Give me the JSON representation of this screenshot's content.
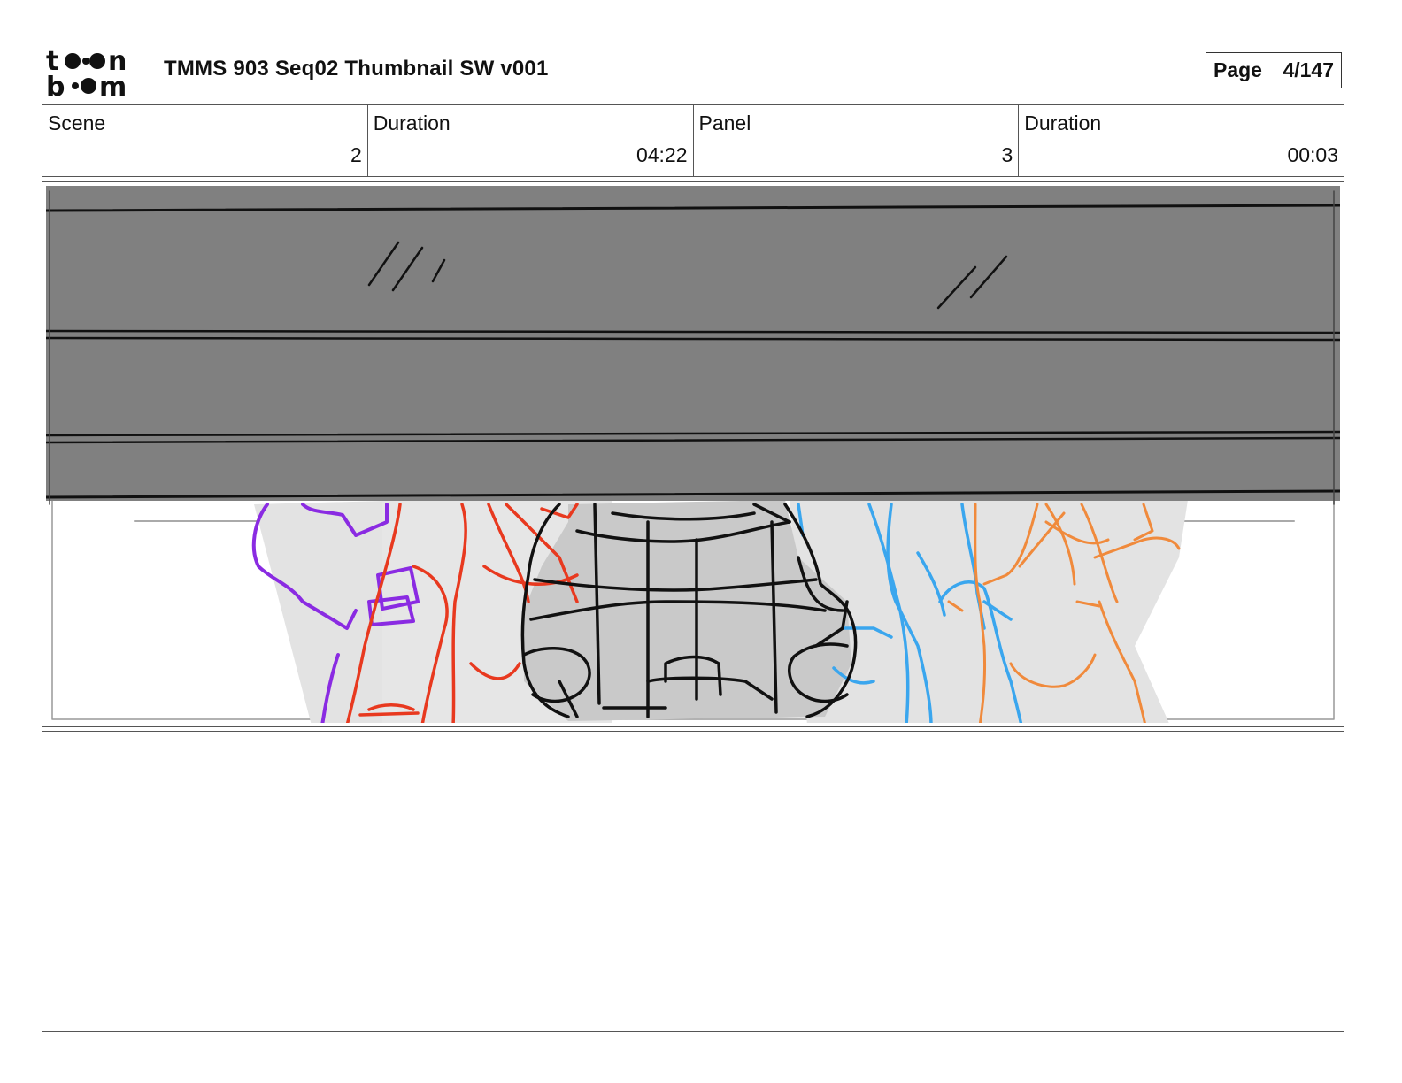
{
  "header": {
    "logo_text_top": "toon",
    "logo_text_bottom": "boom",
    "title": "TMMS 903 Seq02 Thumbnail SW v001",
    "page_label": "Page",
    "page_value": "4/147"
  },
  "info": {
    "scene_label": "Scene",
    "scene_value": "2",
    "scene_duration_label": "Duration",
    "scene_duration_value": "04:22",
    "panel_label": "Panel",
    "panel_value": "3",
    "panel_duration_label": "Duration",
    "panel_duration_value": "00:03"
  },
  "colors": {
    "shadow_band": "#808080",
    "sketch_black": "#111111",
    "purple": "#8a2be2",
    "red": "#e8391f",
    "blue": "#3aa6ee",
    "orange": "#f08a3c",
    "fill_grey": "#e3e3e3"
  },
  "notes": {
    "text": ""
  }
}
